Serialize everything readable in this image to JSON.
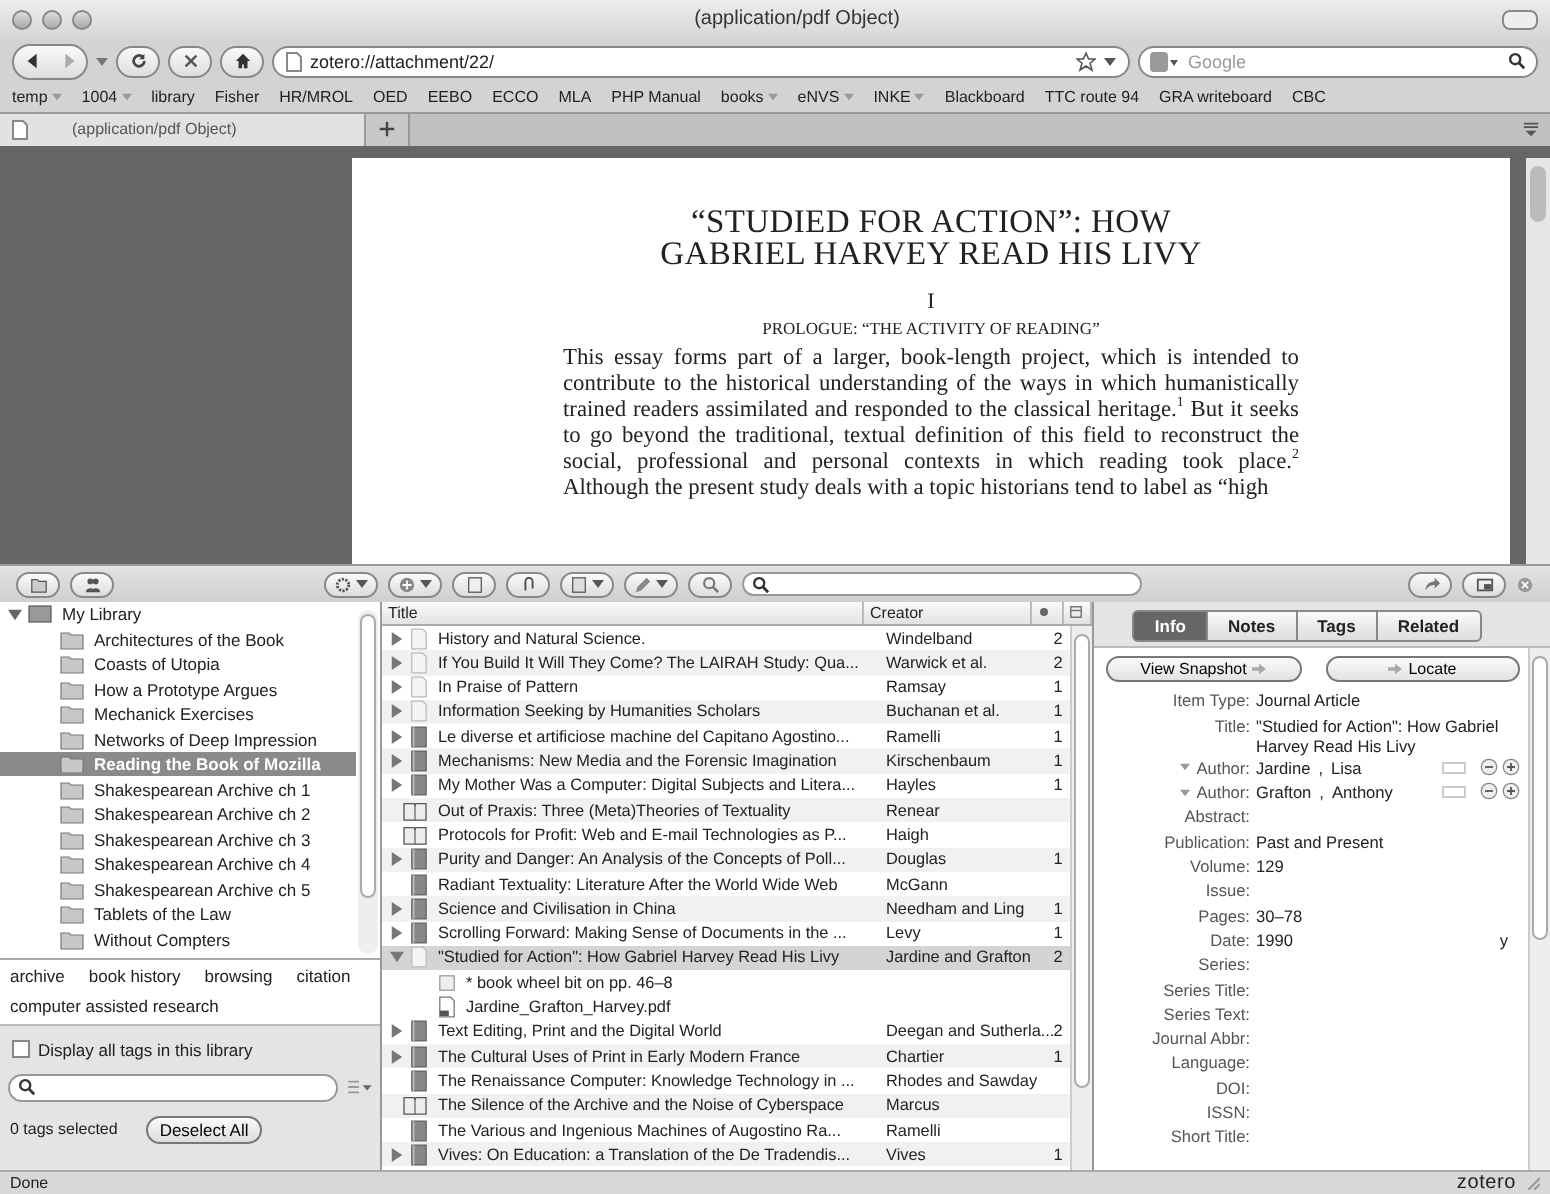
{
  "window": {
    "title": "(application/pdf Object)"
  },
  "nav": {
    "url": "zotero://attachment/22/",
    "search_placeholder": "Google"
  },
  "bookmarks": [
    {
      "label": "temp",
      "menu": true
    },
    {
      "label": "1004",
      "menu": true
    },
    {
      "label": "library",
      "menu": false
    },
    {
      "label": "Fisher",
      "menu": false
    },
    {
      "label": "HR/MROL",
      "menu": false
    },
    {
      "label": "OED",
      "menu": false
    },
    {
      "label": "EEBO",
      "menu": false
    },
    {
      "label": "ECCO",
      "menu": false
    },
    {
      "label": "MLA",
      "menu": false
    },
    {
      "label": "PHP Manual",
      "menu": false
    },
    {
      "label": "books",
      "menu": true
    },
    {
      "label": "eNVS",
      "menu": true
    },
    {
      "label": "INKE",
      "menu": true
    },
    {
      "label": "Blackboard",
      "menu": false
    },
    {
      "label": "TTC route 94",
      "menu": false
    },
    {
      "label": "GRA writeboard",
      "menu": false
    },
    {
      "label": "CBC",
      "menu": false
    }
  ],
  "tabs": [
    {
      "label": "(application/pdf Object)",
      "selected": true
    }
  ],
  "pdf": {
    "title_lines": [
      "“STUDIED FOR ACTION”: HOW",
      "GABRIEL HARVEY READ HIS LIVY"
    ],
    "section_number": "I",
    "section_title": "PROLOGUE: “THE ACTIVITY OF READING”",
    "paragraph": "This essay forms part of a larger, book-length project, which is intended to contribute to the historical understanding of the ways in which humanistically trained readers assimilated and responded to the classical heritage.$^{1}$ But it seeks to go beyond the traditional, textual definition of this field to reconstruct the social, professional and personal contexts in which reading took place.$^{2}$ Although the present study deals with a topic historians tend to label as “high"
  },
  "zotero": {
    "collections": {
      "label": "My Library",
      "expanded": true,
      "children": [
        {
          "label": "Architectures of the Book",
          "selected": false
        },
        {
          "label": "Coasts of Utopia",
          "selected": false
        },
        {
          "label": "How a Prototype Argues",
          "selected": false
        },
        {
          "label": "Mechanick Exercises",
          "selected": false
        },
        {
          "label": "Networks of Deep Impression",
          "selected": false
        },
        {
          "label": "Reading the Book of Mozilla",
          "selected": true
        },
        {
          "label": "Shakespearean Archive ch 1",
          "selected": false
        },
        {
          "label": "Shakespearean Archive ch 2",
          "selected": false
        },
        {
          "label": "Shakespearean Archive ch 3",
          "selected": false
        },
        {
          "label": "Shakespearean Archive ch 4",
          "selected": false
        },
        {
          "label": "Shakespearean Archive ch 5",
          "selected": false
        },
        {
          "label": "Tablets of the Law",
          "selected": false
        },
        {
          "label": "Without Compters",
          "selected": false
        }
      ]
    },
    "tags": [
      "archive",
      "book history",
      "browsing",
      "citation",
      "computer assisted research"
    ],
    "display_all_tags": {
      "label": "Display all tags in this library",
      "checked": false
    },
    "tags_selected": "0 tags selected",
    "deselect_button": "Deselect All",
    "items": {
      "columns": [
        "Title",
        "Creator"
      ],
      "rows": [
        {
          "title": "History and Natural Science.",
          "creator": "Windelband",
          "count": "2",
          "kind": "document",
          "has_children": true,
          "expanded": false,
          "selected": false
        },
        {
          "title": "If You Build It Will They Come? The LAIRAH Study: Qua...",
          "creator": "Warwick et al.",
          "count": "2",
          "kind": "document",
          "has_children": true,
          "expanded": false,
          "selected": false
        },
        {
          "title": "In Praise of Pattern",
          "creator": "Ramsay",
          "count": "1",
          "kind": "document",
          "has_children": true,
          "expanded": false,
          "selected": false
        },
        {
          "title": "Information Seeking by Humanities Scholars",
          "creator": "Buchanan et al.",
          "count": "1",
          "kind": "document",
          "has_children": true,
          "expanded": false,
          "selected": false
        },
        {
          "title": "Le diverse et artificiose machine del Capitano Agostino...",
          "creator": "Ramelli",
          "count": "1",
          "kind": "book",
          "has_children": true,
          "expanded": false,
          "selected": false
        },
        {
          "title": "Mechanisms: New Media and the Forensic Imagination",
          "creator": "Kirschenbaum",
          "count": "1",
          "kind": "book",
          "has_children": true,
          "expanded": false,
          "selected": false
        },
        {
          "title": "My Mother Was a Computer: Digital Subjects and Litera...",
          "creator": "Hayles",
          "count": "1",
          "kind": "book",
          "has_children": true,
          "expanded": false,
          "selected": false
        },
        {
          "title": "Out of Praxis: Three (Meta)Theories of Textuality",
          "creator": "Renear",
          "kind": "article",
          "has_children": false,
          "selected": false
        },
        {
          "title": "Protocols for Profit: Web and E-mail Technologies as P...",
          "creator": "Haigh",
          "kind": "article",
          "has_children": false,
          "selected": false
        },
        {
          "title": "Purity and Danger: An Analysis of the Concepts of Poll...",
          "creator": "Douglas",
          "count": "1",
          "kind": "book",
          "has_children": true,
          "expanded": false,
          "selected": false
        },
        {
          "title": "Radiant Textuality: Literature After the World Wide Web",
          "creator": "McGann",
          "kind": "book",
          "has_children": false,
          "selected": false
        },
        {
          "title": "Science and Civilisation in China",
          "creator": "Needham and Ling",
          "count": "1",
          "kind": "book",
          "has_children": true,
          "expanded": false,
          "selected": false
        },
        {
          "title": "Scrolling Forward: Making Sense of Documents in the ...",
          "creator": "Levy",
          "count": "1",
          "kind": "book",
          "has_children": true,
          "expanded": false,
          "selected": false
        },
        {
          "title": "\"Studied for Action\": How Gabriel Harvey Read His Livy",
          "creator": "Jardine and Grafton",
          "count": "2",
          "kind": "document",
          "has_children": true,
          "expanded": true,
          "selected": true,
          "children": [
            {
              "title": "* book wheel bit on pp. 46–8",
              "kind": "note"
            },
            {
              "title": "Jardine_Grafton_Harvey.pdf",
              "kind": "pdf"
            }
          ]
        },
        {
          "title": "Text Editing, Print and the Digital World",
          "creator": "Deegan and Sutherla...",
          "count": "2",
          "kind": "book",
          "has_children": true,
          "expanded": false,
          "selected": false
        },
        {
          "title": "The Cultural Uses of Print in Early Modern France",
          "creator": "Chartier",
          "count": "1",
          "kind": "book",
          "has_children": true,
          "expanded": false,
          "selected": false
        },
        {
          "title": "The Renaissance Computer: Knowledge Technology in ...",
          "creator": "Rhodes and Sawday",
          "kind": "book",
          "has_children": false,
          "selected": false
        },
        {
          "title": "The Silence of the Archive and the Noise of Cyberspace",
          "creator": "Marcus",
          "kind": "article",
          "has_children": false,
          "selected": false
        },
        {
          "title": "The Various and Ingenious Machines of Augostino Ra...",
          "creator": "Ramelli",
          "kind": "book",
          "has_children": false,
          "selected": false
        },
        {
          "title": "Vives: On Education: a Translation of the De Tradendis...",
          "creator": "Vives",
          "count": "1",
          "kind": "book",
          "has_children": true,
          "expanded": false,
          "selected": false
        }
      ]
    },
    "item_pane": {
      "tabs": [
        {
          "label": "Info",
          "selected": true
        },
        {
          "label": "Notes",
          "selected": false
        },
        {
          "label": "Tags",
          "selected": false
        },
        {
          "label": "Related",
          "selected": false
        }
      ],
      "snapshot_button": "View Snapshot",
      "locate_button": "Locate",
      "fields": [
        {
          "kind": "field",
          "label": "Item Type:",
          "value": "Journal Article"
        },
        {
          "kind": "field",
          "label": "Title:",
          "value": "\"Studied for Action\": How Gabriel Harvey Read His Livy"
        },
        {
          "kind": "author",
          "label": "Author:",
          "last": "Jardine",
          "separator": ",",
          "first": "Lisa"
        },
        {
          "kind": "author",
          "label": "Author:",
          "last": "Grafton",
          "separator": ",",
          "first": "Anthony"
        },
        {
          "kind": "field",
          "label": "Abstract:"
        },
        {
          "kind": "field",
          "label": "Publication:",
          "value": "Past and Present"
        },
        {
          "kind": "field",
          "label": "Volume:",
          "value": "129"
        },
        {
          "kind": "field",
          "label": "Issue:"
        },
        {
          "kind": "field",
          "label": "Pages:",
          "value": "30–78"
        },
        {
          "kind": "field",
          "label": "Date:",
          "value": "1990",
          "flag": "y"
        },
        {
          "kind": "field",
          "label": "Series:"
        },
        {
          "kind": "field",
          "label": "Series Title:"
        },
        {
          "kind": "field",
          "label": "Series Text:"
        },
        {
          "kind": "field",
          "label": "Journal Abbr:"
        },
        {
          "kind": "field",
          "label": "Language:"
        },
        {
          "kind": "field",
          "label": "DOI:"
        },
        {
          "kind": "field",
          "label": "ISSN:"
        },
        {
          "kind": "field",
          "label": "Short Title:"
        }
      ]
    },
    "brand": "zotero"
  },
  "status_bar": "Done"
}
